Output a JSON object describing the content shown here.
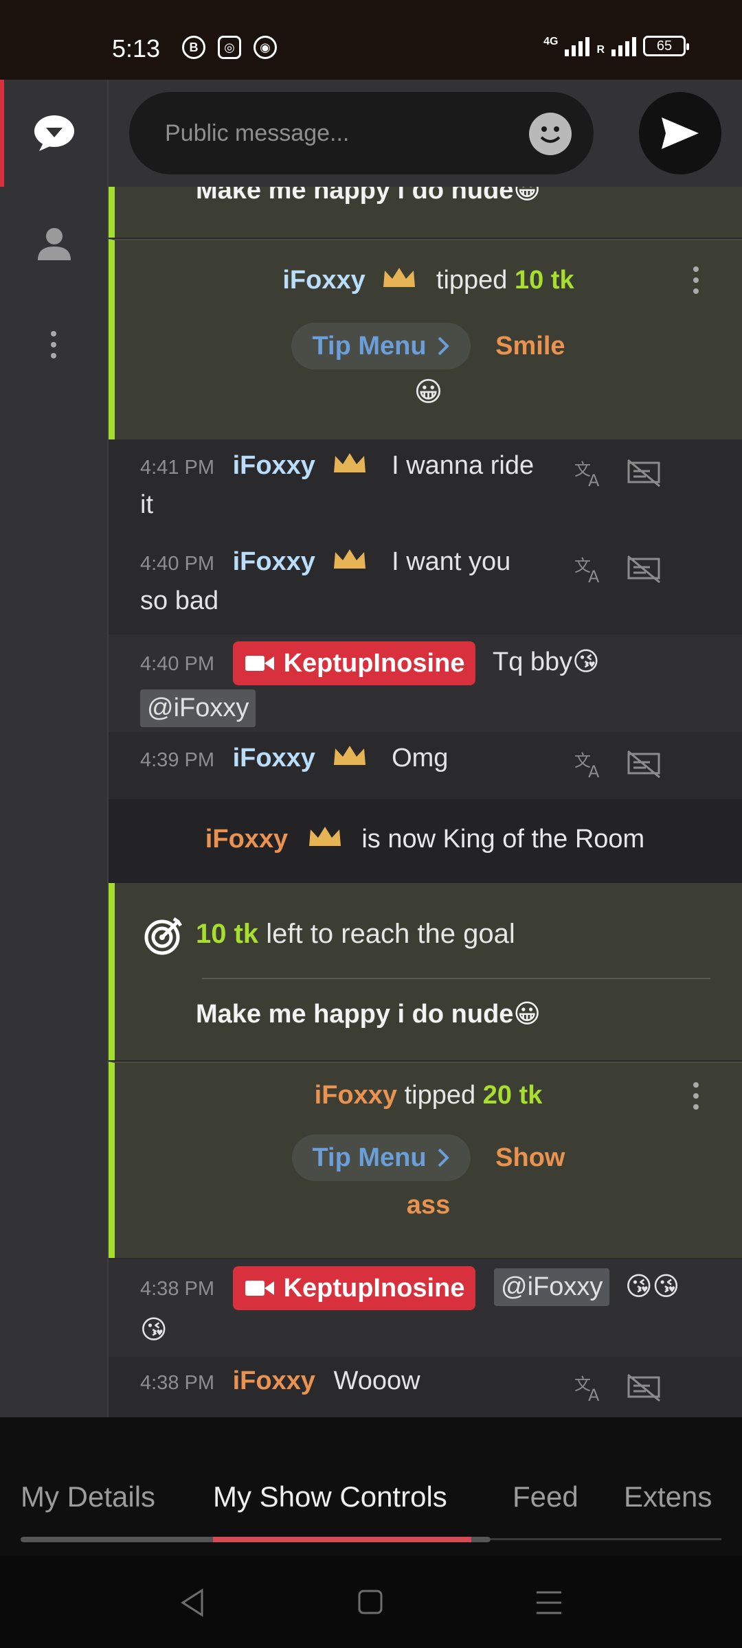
{
  "status_bar": {
    "time": "5:13",
    "network": "4G",
    "roaming": "R",
    "battery": "65"
  },
  "composer": {
    "placeholder": "Public message..."
  },
  "chat": {
    "top_partial_text": "Make me happy i do nude😀",
    "tip1": {
      "name": "iFoxxy",
      "action": "tipped",
      "amount": "10 tk",
      "menu_label": "Tip Menu",
      "item": "Smile",
      "emoji": "😀"
    },
    "messages": [
      {
        "time": "4:41 PM",
        "name": "iFoxxy",
        "text": "I wanna ride",
        "cont": "it"
      },
      {
        "time": "4:40 PM",
        "name": "iFoxxy",
        "text": "I want you",
        "cont": "so bad"
      },
      {
        "time": "4:40 PM",
        "name": "KeptupInosine",
        "text": "Tq bby😘",
        "mention": "@iFoxxy"
      },
      {
        "time": "4:39 PM",
        "name": "iFoxxy",
        "text": "Omg"
      }
    ],
    "king": {
      "name": "iFoxxy",
      "text": "is now King of the Room"
    },
    "goal": {
      "amount": "10 tk",
      "text": "left to reach the goal",
      "title": "Make me happy i do nude😀"
    },
    "tip2": {
      "name": "iFoxxy",
      "action": "tipped",
      "amount": "20 tk",
      "menu_label": "Tip Menu",
      "item": "Show",
      "item_cont": "ass"
    },
    "messages2": [
      {
        "time": "4:38 PM",
        "name": "KeptupInosine",
        "mention": "@iFoxxy",
        "emojis": "😘😘",
        "cont": "😘"
      },
      {
        "time": "4:38 PM",
        "name": "iFoxxy",
        "text": "Wooow"
      }
    ]
  },
  "tabs": [
    "My Details",
    "My Show Controls",
    "Feed",
    "Extens"
  ],
  "colors": {
    "accent_red": "#d9303d",
    "goal_green": "#a6de2c",
    "orange": "#ea9350",
    "blue_name": "#b9ddfa",
    "crown": "#e6b455"
  }
}
